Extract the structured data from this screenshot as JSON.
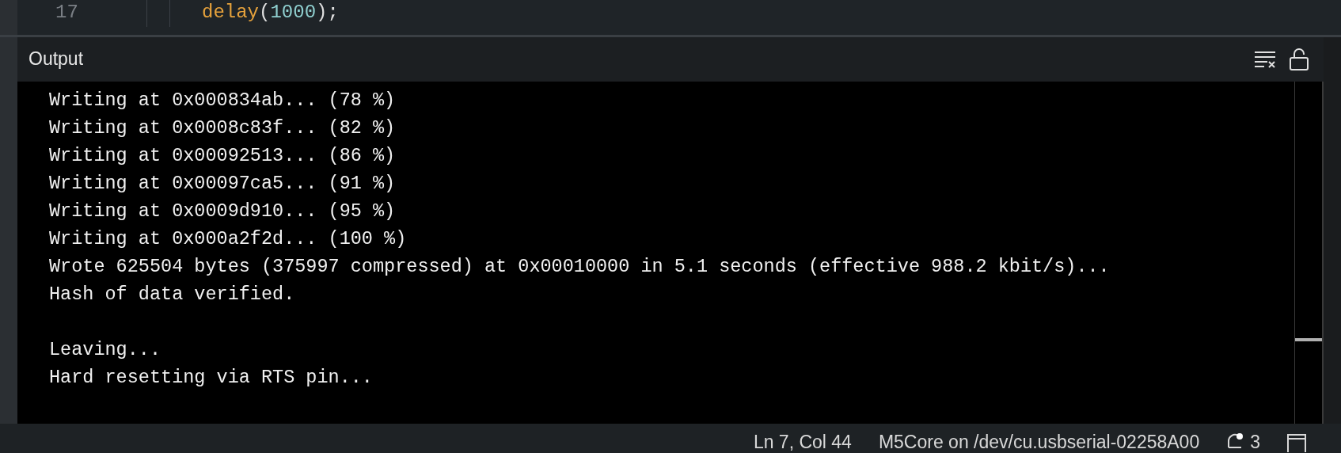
{
  "editor": {
    "line_number": "17",
    "code": [
      {
        "kind": "function",
        "text": "delay"
      },
      {
        "kind": "punct",
        "text": "("
      },
      {
        "kind": "number",
        "text": "1000"
      },
      {
        "kind": "punct",
        "text": ");"
      }
    ]
  },
  "output": {
    "title": "Output",
    "blocks": [
      [
        "Writing at 0x000834ab... (78 %)",
        "Writing at 0x0008c83f... (82 %)",
        "Writing at 0x00092513... (86 %)",
        "Writing at 0x00097ca5... (91 %)",
        "Writing at 0x0009d910... (95 %)",
        "Writing at 0x000a2f2d... (100 %)",
        "Wrote 625504 bytes (375997 compressed) at 0x00010000 in 5.1 seconds (effective 988.2 kbit/s)...",
        "Hash of data verified."
      ],
      [
        "Leaving...",
        "Hard resetting via RTS pin..."
      ]
    ]
  },
  "status_bar": {
    "position": "Ln 7, Col 44",
    "board": "M5Core on /dev/cu.usbserial-02258A00",
    "notifications": "3"
  }
}
